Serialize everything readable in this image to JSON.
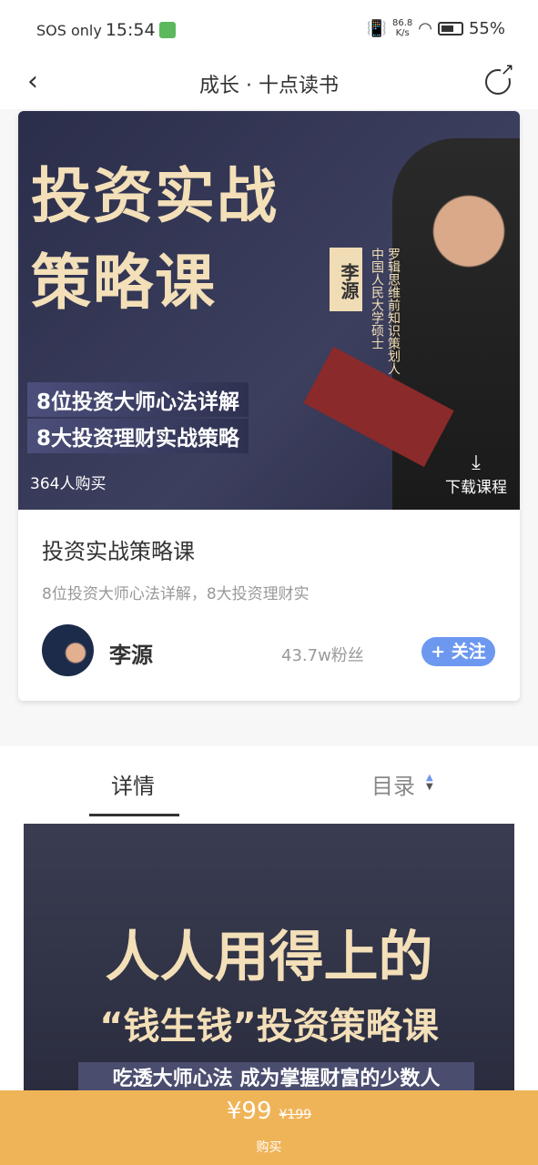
{
  "status": {
    "carrier": "SOS only",
    "time": "15:54",
    "speed": "86.8",
    "speed_unit": "K/s",
    "battery": "55%"
  },
  "nav": {
    "title": "成长 · 十点读书"
  },
  "cover": {
    "headline1": "投资实战",
    "headline2": "策略课",
    "tag1": "8位投资大师心法详解",
    "tag2": "8大投资理财实战策略",
    "author_tag": "李源",
    "role1": "罗辑思维前知识策划人",
    "role2": "中国人民大学硕士",
    "buyers": "364人购买",
    "download": "下载课程"
  },
  "course": {
    "title": "投资实战策略课",
    "desc": "8位投资大师心法详解，8大投资理财实",
    "author": "李源",
    "fans": "43.7w粉丝",
    "follow": "+ 关注"
  },
  "tabs": {
    "detail": "详情",
    "catalog": "目录"
  },
  "detail_image": {
    "line1": "人人用得上的",
    "line2": "“钱生钱”投资策略课",
    "line3": "吃透大师心法 成为掌握财富的少数人"
  },
  "buy": {
    "price": "¥99",
    "original": "¥199",
    "label": "购买"
  },
  "colors": {
    "accent": "#6d98f0",
    "buy_bar": "#f0b458"
  }
}
